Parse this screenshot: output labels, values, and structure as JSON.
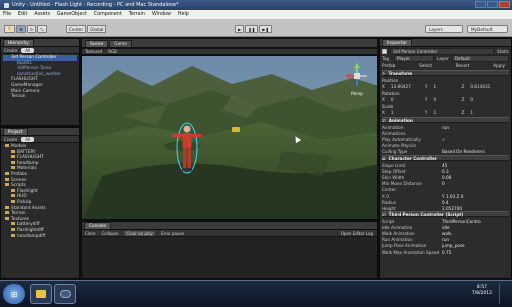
{
  "window": {
    "title": "Unity - Untitled - Flash Light - Recording - PC and Mac Standalone*"
  },
  "menu": [
    "File",
    "Edit",
    "Assets",
    "GameObject",
    "Component",
    "Terrain",
    "Window",
    "Help"
  ],
  "toolbar": {
    "tools": [
      "hand-icon",
      "move-icon",
      "rotate-icon",
      "scale-icon"
    ],
    "pivot_label": "Center",
    "space_label": "Global",
    "play_icons": [
      "play-icon",
      "pause-icon",
      "step-icon"
    ],
    "layers_label": "Layers",
    "layout_label": "MyDefault"
  },
  "hierarchy": {
    "tab": "Hierarchy",
    "create": "Create",
    "search": "All",
    "items": [
      {
        "label": "3rd Person Controller",
        "selected": true,
        "indent": 0
      },
      {
        "label": "Bip001",
        "indent": 1
      },
      {
        "label": "3rdPerson Torso",
        "indent": 1
      },
      {
        "label": "construction_worker",
        "indent": 1
      },
      {
        "label": "FLASHLIGHT",
        "indent": 0
      },
      {
        "label": "GameManager",
        "indent": 0
      },
      {
        "label": "Main Camera",
        "indent": 0
      },
      {
        "label": "Terrain",
        "indent": 0
      }
    ]
  },
  "project": {
    "tab": "Project",
    "create": "Create",
    "search": "All",
    "items": [
      {
        "label": "Models",
        "indent": 0
      },
      {
        "label": "BATTERY",
        "indent": 1
      },
      {
        "label": "FLASHLIGHT",
        "indent": 1
      },
      {
        "label": "headlamp",
        "indent": 1
      },
      {
        "label": "Materials",
        "indent": 1
      },
      {
        "label": "Prefabs",
        "indent": 0
      },
      {
        "label": "Scenes",
        "indent": 0
      },
      {
        "label": "Scripts",
        "indent": 0
      },
      {
        "label": "Flashlight",
        "indent": 1
      },
      {
        "label": "HUD",
        "indent": 1
      },
      {
        "label": "PickUp",
        "indent": 1
      },
      {
        "label": "Standard Assets",
        "indent": 0
      },
      {
        "label": "Terrain",
        "indent": 0
      },
      {
        "label": "Textures",
        "indent": 0
      },
      {
        "label": "batterydiff",
        "indent": 1
      },
      {
        "label": "flashlightdiff",
        "indent": 1
      },
      {
        "label": "headlampdiff",
        "indent": 1
      }
    ]
  },
  "scene": {
    "tabs": [
      "Scene",
      "Game"
    ],
    "shading": "Textured",
    "mode": "RGB",
    "persp_label": "Persp",
    "gizmo_axes": {
      "y": "y",
      "x": "x",
      "z": "z"
    }
  },
  "console": {
    "tab": "Console",
    "buttons": [
      "Clear",
      "Collapse",
      "Clear on play",
      "Error pause"
    ],
    "right": "Open Editor Log"
  },
  "inspector": {
    "tab": "Inspector",
    "object_name": "3rd Person Controller",
    "static_label": "Static",
    "tag_label": "Tag",
    "tag_value": "Player",
    "layer_label": "Layer",
    "layer_value": "Default",
    "prefab_labels": [
      "Prefab",
      "Select",
      "Revert",
      "Apply"
    ],
    "transform": {
      "title": "Transform",
      "position_label": "Position",
      "position": {
        "x": "13.80427",
        "y": "1",
        "z": "0.814431"
      },
      "rotation_label": "Rotation",
      "rotation": {
        "x": "0",
        "y": "0",
        "z": "0"
      },
      "scale_label": "Scale",
      "scale": {
        "x": "1",
        "y": "1",
        "z": "1"
      }
    },
    "animation": {
      "title": "Animation",
      "rows": [
        {
          "k": "Animation",
          "v": "run"
        },
        {
          "k": "Animations",
          "v": ""
        },
        {
          "k": "Play Automatically",
          "v": "✓"
        },
        {
          "k": "Animate Physics",
          "v": ""
        },
        {
          "k": "Culling Type",
          "v": "Based On Renderers"
        }
      ]
    },
    "character_controller": {
      "title": "Character Controller",
      "rows": [
        {
          "k": "Slope Limit",
          "v": "45"
        },
        {
          "k": "Step Offset",
          "v": "0.3"
        },
        {
          "k": "Skin Width",
          "v": "0.08"
        },
        {
          "k": "Min Move Distance",
          "v": "0"
        },
        {
          "k": "Center",
          "v": ""
        },
        {
          "k": "X 0",
          "v": "Y 1.03   Z 0"
        },
        {
          "k": "Radius",
          "v": "0.4"
        },
        {
          "k": "Height",
          "v": "2.052700"
        }
      ]
    },
    "third_person": {
      "title": "Third Person Controller (Script)",
      "rows": [
        {
          "k": "Script",
          "v": "ThirdPersonContro"
        },
        {
          "k": "Idle Animation",
          "v": "idle"
        },
        {
          "k": "Walk Animation",
          "v": "walk"
        },
        {
          "k": "Run Animation",
          "v": "run"
        },
        {
          "k": "Jump Pose Animation",
          "v": "jump_pose"
        },
        {
          "k": "Walk Max Animation Speed",
          "v": "0.75"
        }
      ]
    }
  },
  "taskbar": {
    "time": "8:57",
    "date": "7/8/2012"
  },
  "colors": {
    "accent": "#3a5f9a",
    "sky": "#5a7da0",
    "terrain": "#3d5a2e"
  }
}
